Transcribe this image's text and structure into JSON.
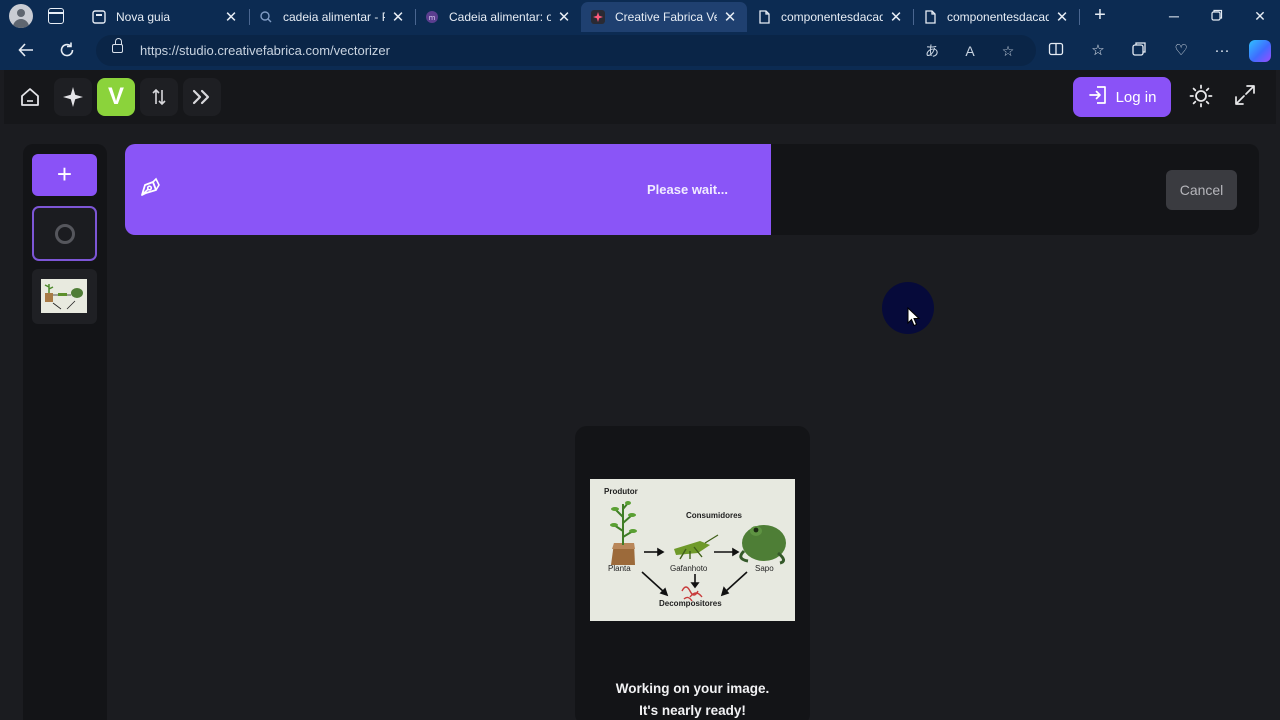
{
  "browser": {
    "tabs": [
      {
        "title": "Nova guia",
        "icon": "new-tab-icon",
        "active": false
      },
      {
        "title": "cadeia alimentar - Pe",
        "icon": "search-icon",
        "active": false
      },
      {
        "title": "Cadeia alimentar: o q",
        "icon": "site-icon",
        "active": false
      },
      {
        "title": "Creative Fabrica Vect",
        "icon": "creative-fabrica-icon",
        "active": true
      },
      {
        "title": "componentesdacade",
        "icon": "document-icon",
        "active": false
      },
      {
        "title": "componentesdacade",
        "icon": "document-icon",
        "active": false
      }
    ],
    "url": "https://studio.creativefabrica.com/vectorizer"
  },
  "toolbar": {
    "logo_letter": "V",
    "login_label": "Log in"
  },
  "banner": {
    "status": "Please wait...",
    "progress": 0.57,
    "cancel_label": "Cancel"
  },
  "preview": {
    "labels": {
      "produtor": "Produtor",
      "consumidores": "Consumidores",
      "planta": "Planta",
      "gafanhoto": "Gafanhoto",
      "sapo": "Sapo",
      "decompositores": "Decompositores"
    },
    "message_line1": "Working on your image.",
    "message_line2": "It's nearly ready!"
  },
  "colors": {
    "accent": "#8a52f7",
    "logo": "#8bd33b",
    "browser_chrome": "#0c2b52"
  }
}
